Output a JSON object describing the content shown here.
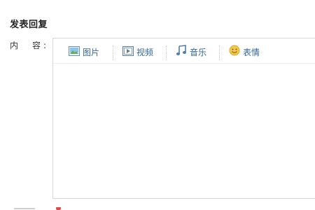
{
  "page": {
    "title": "发表回复",
    "content_label": "内　容:"
  },
  "toolbar": {
    "items": [
      {
        "label": "图片",
        "icon": "image-icon"
      },
      {
        "label": "视频",
        "icon": "video-icon"
      },
      {
        "label": "音乐",
        "icon": "music-icon"
      },
      {
        "label": "表情",
        "icon": "emoji-icon"
      }
    ]
  },
  "colors": {
    "link": "#336699",
    "border": "#d8d8d8",
    "emoji": "#f2c94c"
  }
}
